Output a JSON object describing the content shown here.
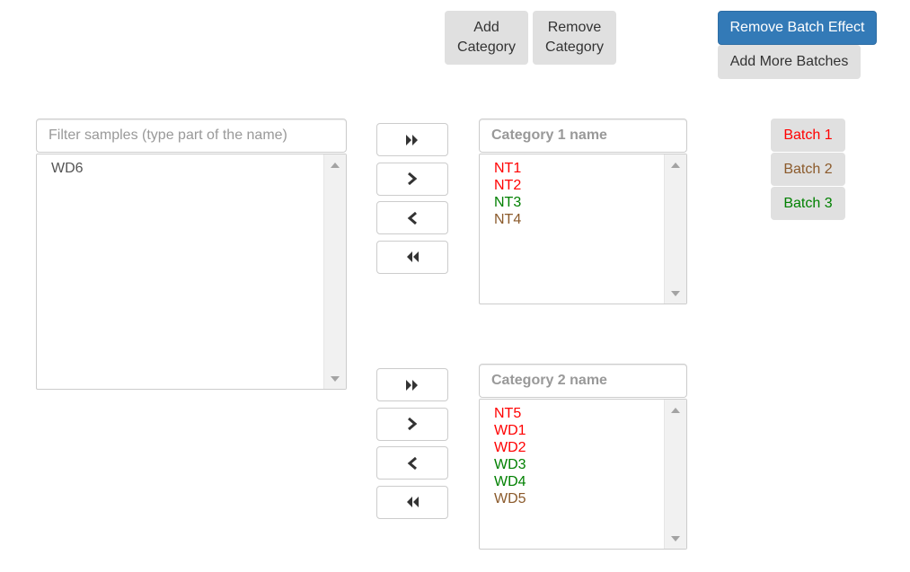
{
  "toolbar": {
    "add_category_line1": "Add",
    "add_category_line2": "Category",
    "remove_category_line1": "Remove",
    "remove_category_line2": "Category",
    "remove_batch_effect": "Remove Batch Effect",
    "add_more_batches": "Add More Batches"
  },
  "samples": {
    "filter_placeholder": "Filter samples (type part of the name)",
    "items": [
      {
        "label": "WD6",
        "color": "#555555"
      }
    ]
  },
  "categories": [
    {
      "name_placeholder": "Category 1 name",
      "items": [
        {
          "label": "NT1",
          "color": "#ff0000"
        },
        {
          "label": "NT2",
          "color": "#ff0000"
        },
        {
          "label": "NT3",
          "color": "#008000"
        },
        {
          "label": "NT4",
          "color": "#8b5a2b"
        }
      ]
    },
    {
      "name_placeholder": "Category 2 name",
      "items": [
        {
          "label": "NT5",
          "color": "#ff0000"
        },
        {
          "label": "WD1",
          "color": "#ff0000"
        },
        {
          "label": "WD2",
          "color": "#ff0000"
        },
        {
          "label": "WD3",
          "color": "#008000"
        },
        {
          "label": "WD4",
          "color": "#008000"
        },
        {
          "label": "WD5",
          "color": "#8b5a2b"
        }
      ]
    }
  ],
  "transfer_buttons": [
    "move-all-right-icon",
    "move-right-icon",
    "move-left-icon",
    "move-all-left-icon"
  ],
  "batches": [
    {
      "label": "Batch 1",
      "color": "#ff0000"
    },
    {
      "label": "Batch 2",
      "color": "#8b5a2b"
    },
    {
      "label": "Batch 3",
      "color": "#008000"
    }
  ]
}
